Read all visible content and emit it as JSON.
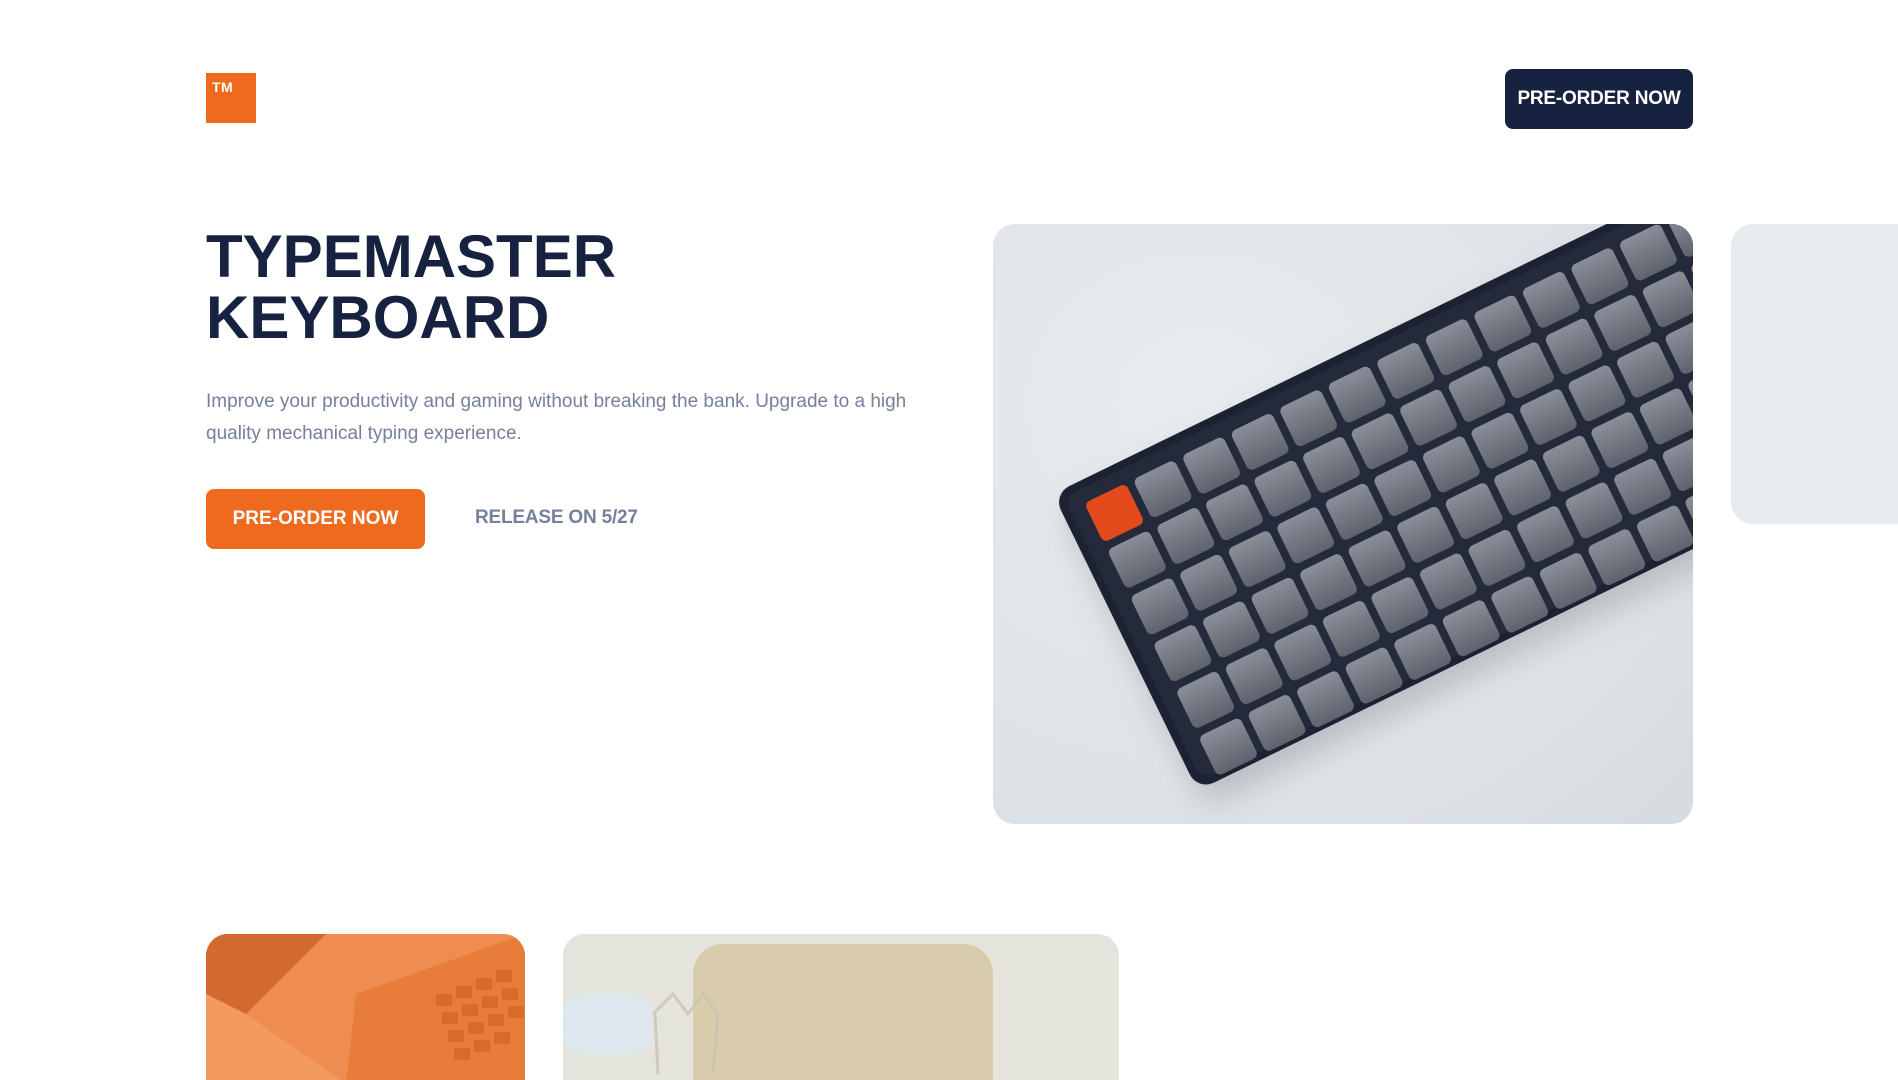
{
  "theme": {
    "accent": "#ee6a1f",
    "navy": "#16223f",
    "muted": "#75809a"
  },
  "header": {
    "logo_text": "TM",
    "cta_label": "PRE-ORDER NOW"
  },
  "hero": {
    "title_line1": "TYPEMASTER",
    "title_line2": "KEYBOARD",
    "description": "Improve your productivity and gaming without breaking the bank. Upgrade to a high quality mechanical typing experience.",
    "cta_label": "PRE-ORDER NOW",
    "release_text": "RELEASE ON 5/27",
    "image_icon": "keyboard-photo"
  },
  "gallery": {
    "tiles": [
      {
        "icon": "orange-keyboard-photo"
      },
      {
        "icon": "desk-scene-photo"
      }
    ]
  }
}
